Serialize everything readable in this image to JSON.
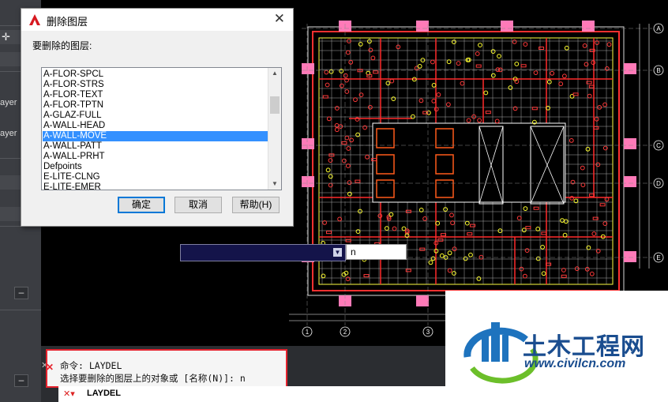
{
  "left_panel": {
    "labels": [
      "ayer",
      "ayer"
    ]
  },
  "dialog": {
    "title": "删除图层",
    "prompt": "要删除的图层:",
    "layers": [
      "A-FLOR-SPCL",
      "A-FLOR-STRS",
      "A-FLOR-TEXT",
      "A-FLOR-TPTN",
      "A-GLAZ-FULL",
      "A-WALL-HEAD",
      "A-WALL-MOVE",
      "A-WALL-PATT",
      "A-WALL-PRHT",
      "Defpoints",
      "E-LITE-CLNG",
      "E-LITE-EMER"
    ],
    "selected_index": 6,
    "ok_label": "确定",
    "cancel_label": "取消",
    "help_label": "帮助(H)"
  },
  "dynamic_input": {
    "value": "n"
  },
  "axis": {
    "row_labels": [
      "A",
      "B",
      "C",
      "D",
      "E"
    ],
    "col_labels": [
      "1",
      "2",
      "3"
    ]
  },
  "command": {
    "history_line1": "命令: LAYDEL",
    "history_line2": "选择要删除的图层上的对象或 [名称(N)]: n",
    "current": "LAYDEL"
  },
  "watermark": {
    "name": "土木工程网",
    "url": "www.civilcn.com"
  },
  "colors": {
    "accent": "#3390ff",
    "highlight_box": "#e5232e",
    "brand": "#1a4d8f"
  }
}
